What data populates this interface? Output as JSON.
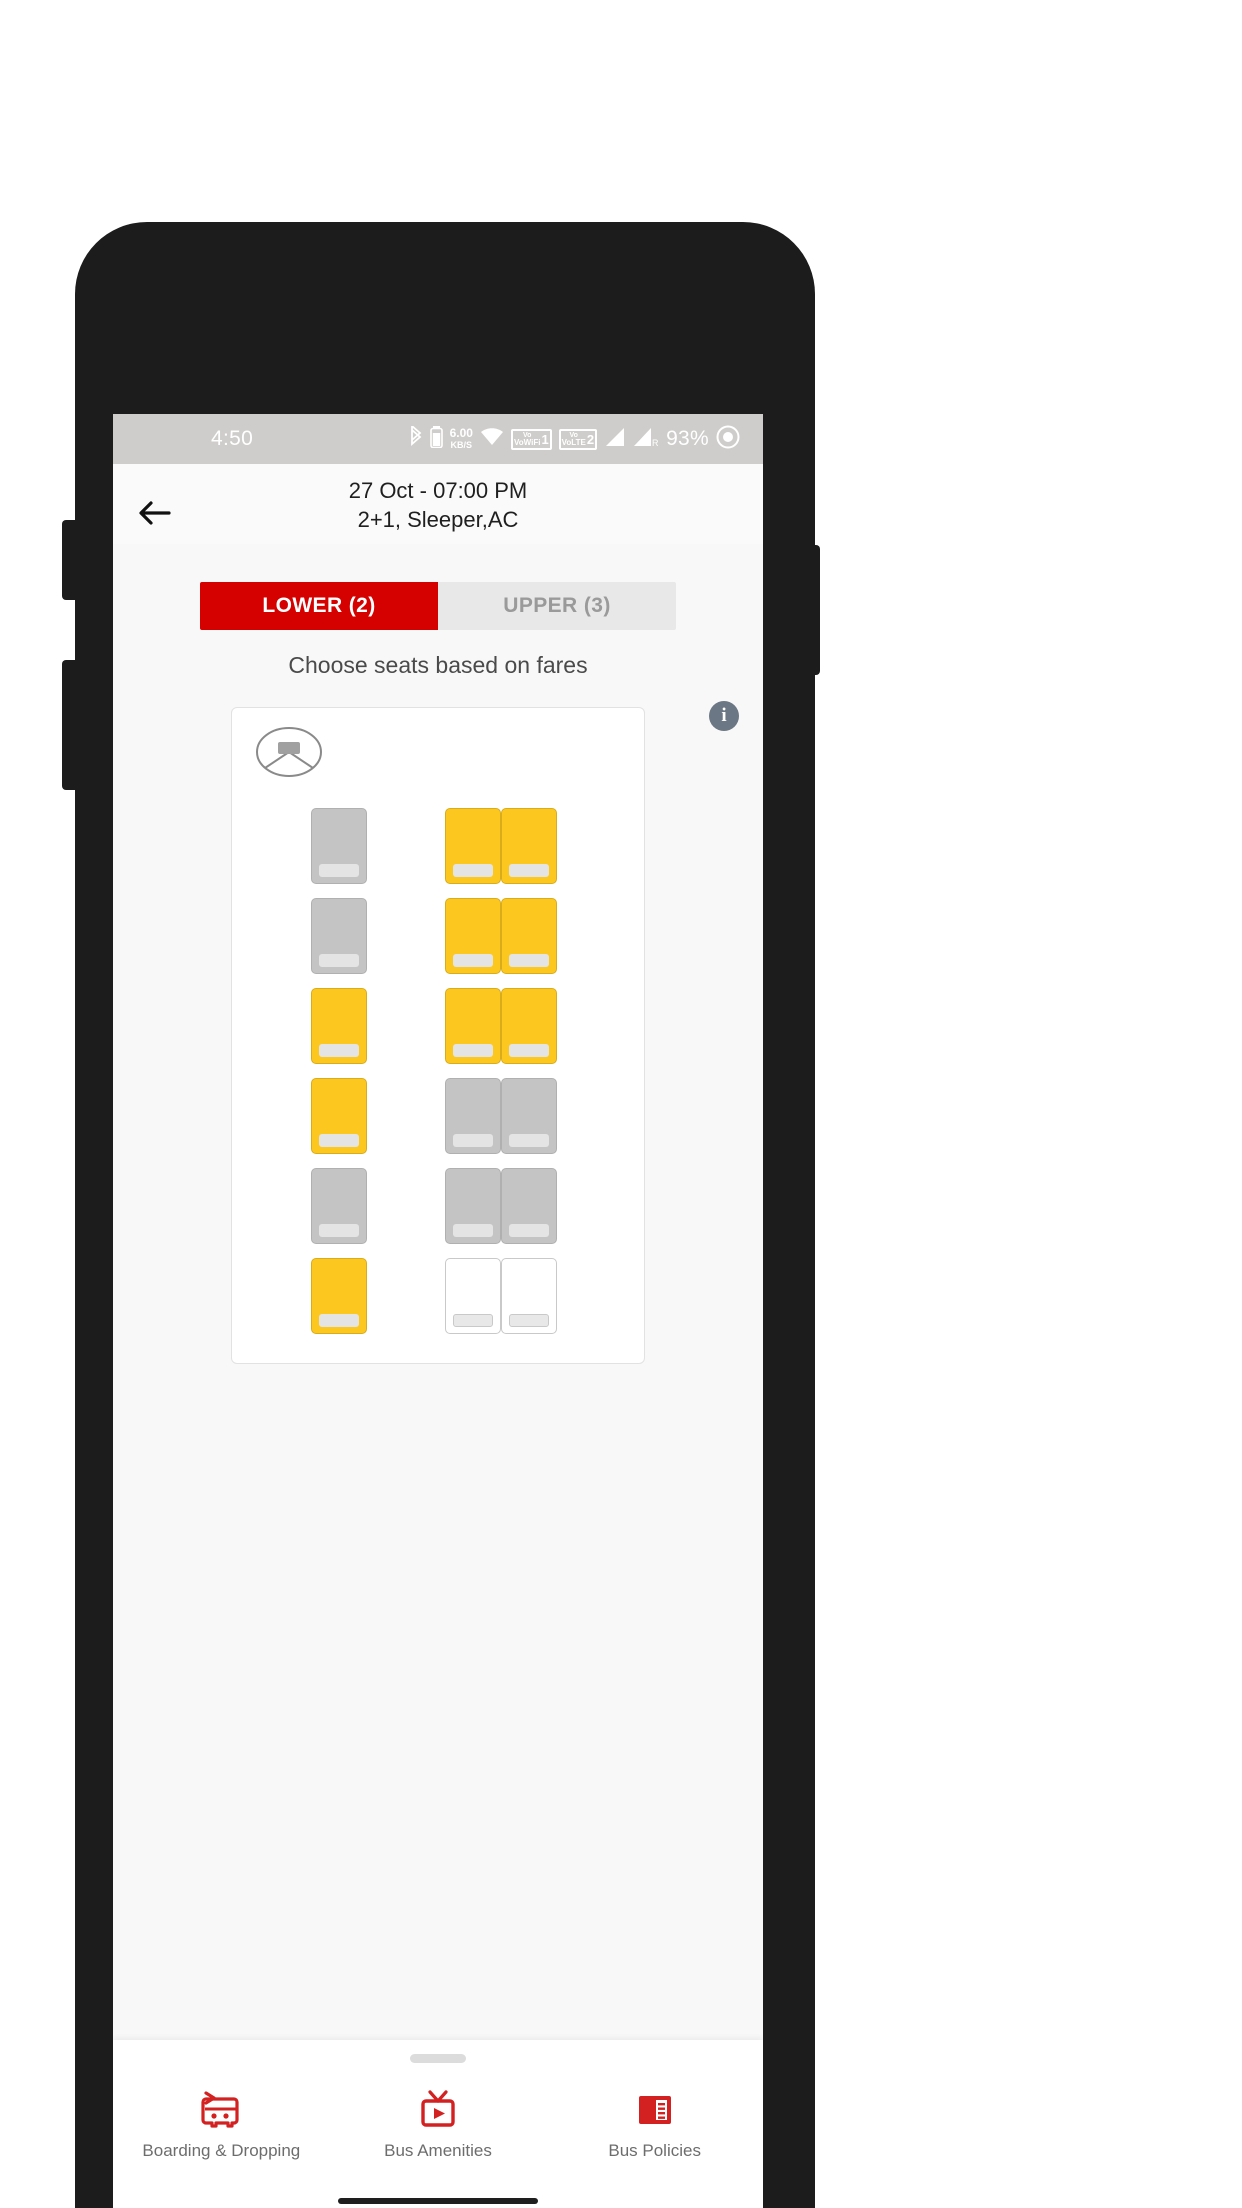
{
  "status_bar": {
    "time": "4:50",
    "net_speed_value": "6.00",
    "net_speed_unit": "KB/S",
    "sim1_label": "VoWiFi",
    "sim1_number": "1",
    "sim2_label": "VoLTE",
    "sim2_number": "2",
    "roaming_label": "R",
    "battery": "93%",
    "icons": [
      "bluetooth-icon",
      "battery-icon",
      "wifi-icon",
      "signal-icon-1",
      "signal-icon-2",
      "screen-recorder-icon"
    ]
  },
  "header": {
    "back_icon": "back-arrow-icon",
    "line1": "27 Oct - 07:00 PM",
    "line2": "2+1, Sleeper,AC"
  },
  "tabs": [
    {
      "label": "LOWER (2)",
      "active": true
    },
    {
      "label": "UPPER (3)",
      "active": false
    }
  ],
  "subtitle": "Choose seats based on fares",
  "info_icon": {
    "glyph": "i",
    "name": "info-icon"
  },
  "deck": {
    "driver_icon": "steering-wheel-icon",
    "legend_colors": {
      "available": "#fcc81f",
      "booked": "#c4c4c4",
      "empty": "#ffffff"
    },
    "rows": [
      [
        "booked",
        "aisle",
        "available",
        "available"
      ],
      [
        "booked",
        "aisle",
        "available",
        "available"
      ],
      [
        "available",
        "aisle",
        "available",
        "available"
      ],
      [
        "available",
        "aisle",
        "booked",
        "booked"
      ],
      [
        "booked",
        "aisle",
        "booked",
        "booked"
      ],
      [
        "available",
        "aisle",
        "empty",
        "empty"
      ]
    ]
  },
  "bottom_sheet": {
    "handle": "drag-handle",
    "nav": [
      {
        "label": "Boarding & Dropping",
        "icon": "bus-icon"
      },
      {
        "label": "Bus Amenities",
        "icon": "tv-icon"
      },
      {
        "label": "Bus Policies",
        "icon": "policy-document-icon"
      }
    ]
  },
  "colors": {
    "brand_red": "#d50000",
    "seat_available": "#fcc81f",
    "seat_booked": "#c4c4c4",
    "status_bar_bg": "#cfcdcb"
  }
}
